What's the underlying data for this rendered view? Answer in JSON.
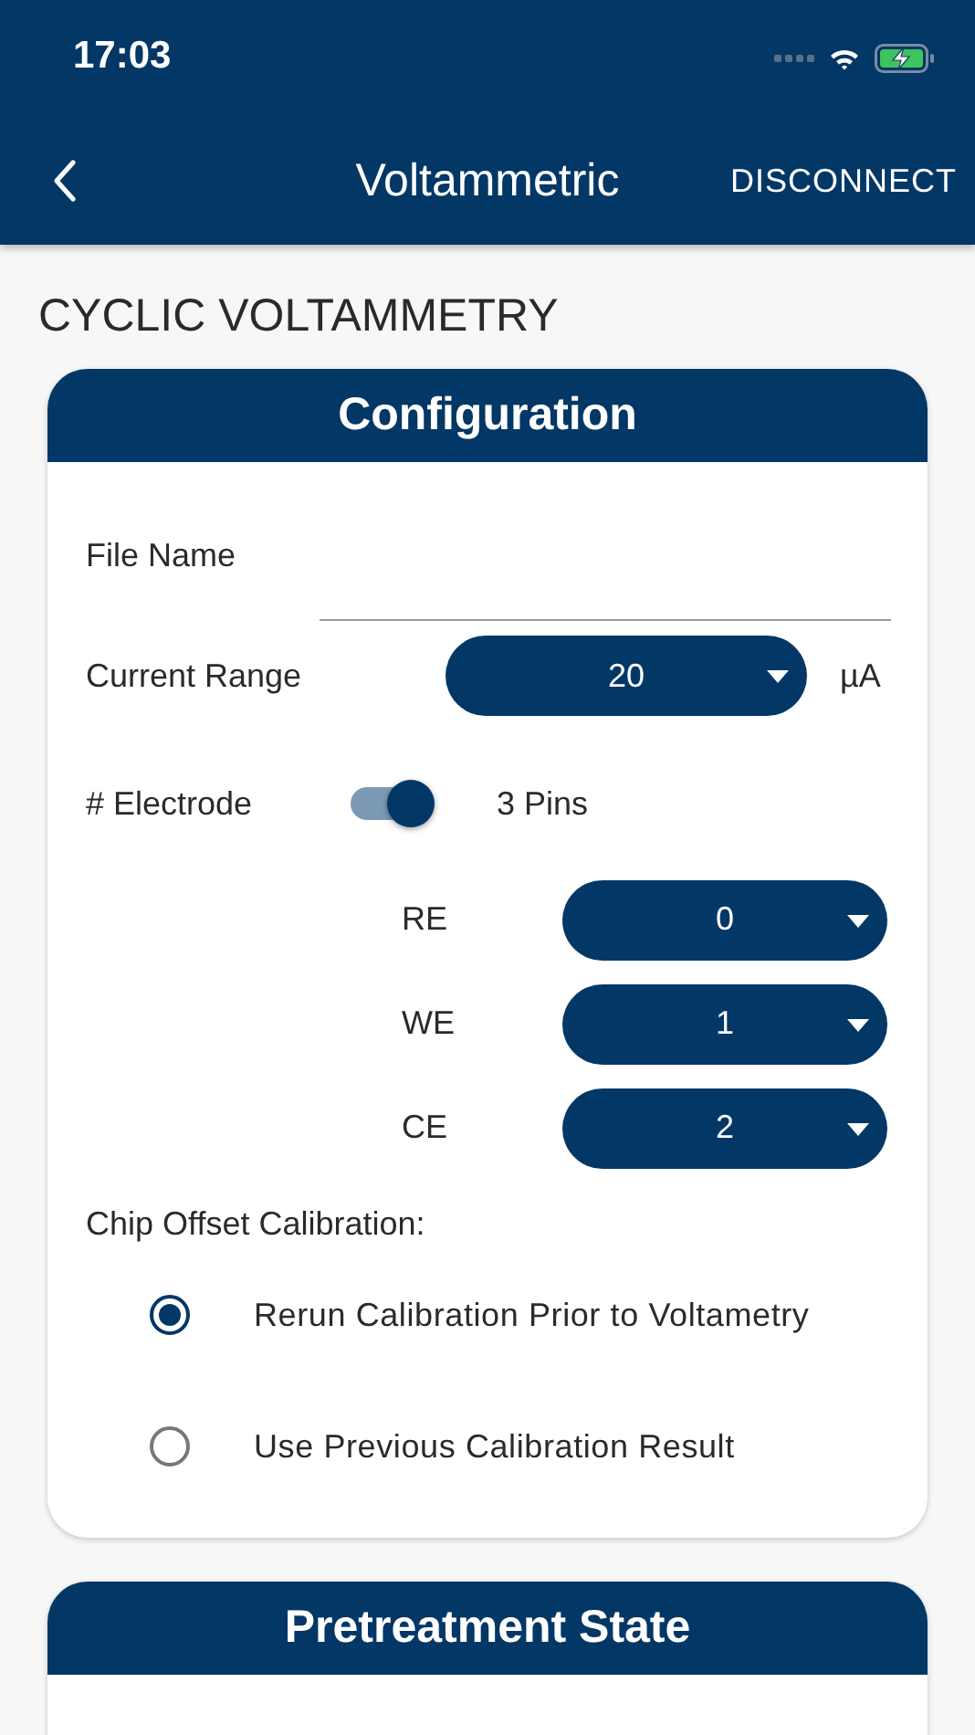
{
  "status_bar": {
    "time": "17:03"
  },
  "nav_bar": {
    "title": "Voltammetric",
    "action": "DISCONNECT"
  },
  "section_title": "CYCLIC VOLTAMMETRY",
  "configuration": {
    "title": "Configuration",
    "file_name": {
      "label": "File Name"
    },
    "current_range": {
      "label": "Current Range",
      "value": "20",
      "unit": "µA"
    },
    "electrode": {
      "label": "# Electrode",
      "on": true,
      "value": "3 Pins"
    },
    "pins": [
      {
        "label": "RE",
        "value": "0"
      },
      {
        "label": "WE",
        "value": "1"
      },
      {
        "label": "CE",
        "value": "2"
      }
    ],
    "calibration": {
      "label": "Chip Offset Calibration:",
      "options": [
        {
          "label": "Rerun Calibration Prior to Voltametry",
          "selected": true
        },
        {
          "label": "Use Previous Calibration Result",
          "selected": false
        }
      ]
    }
  },
  "pretreatment": {
    "title": "Pretreatment State"
  }
}
